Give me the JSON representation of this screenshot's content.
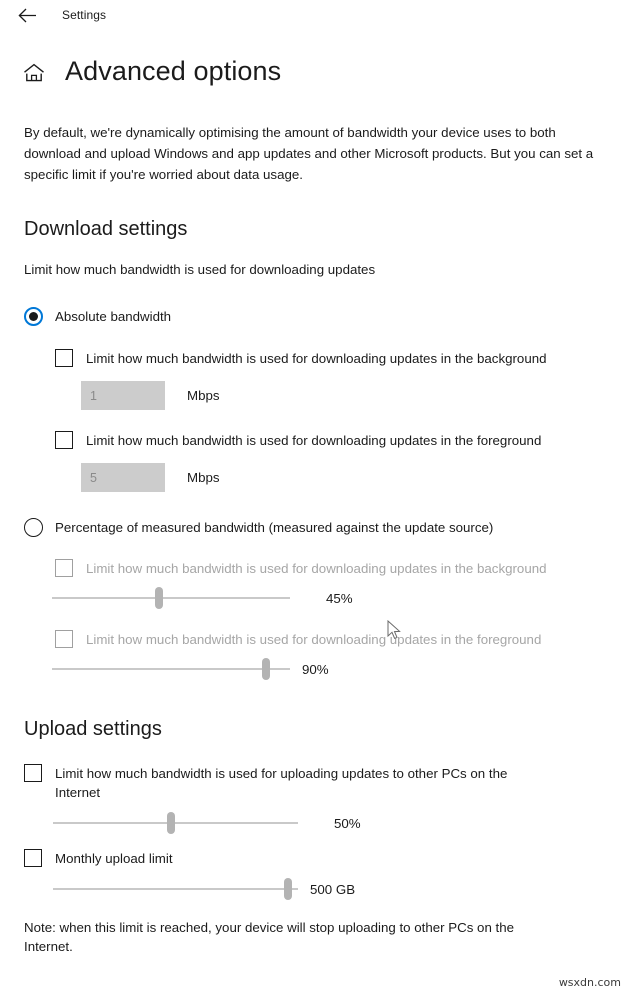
{
  "titlebar": {
    "back_icon": "back-arrow-icon",
    "app_name": "Settings"
  },
  "header": {
    "home_icon": "home-icon",
    "title": "Advanced options"
  },
  "intro": "By default, we're dynamically optimising the amount of bandwidth your device uses to both download and upload Windows and app updates and other Microsoft products. But you can set a specific limit if you're worried about data usage.",
  "download": {
    "heading": "Download settings",
    "sub_label": "Limit how much bandwidth is used for downloading updates",
    "absolute": {
      "radio_label": "Absolute bandwidth",
      "selected": true,
      "background": {
        "checkbox_label": "Limit how much bandwidth is used for downloading updates in the background",
        "checked": false,
        "value": "1",
        "unit": "Mbps"
      },
      "foreground": {
        "checkbox_label": "Limit how much bandwidth is used for downloading updates in the foreground",
        "checked": false,
        "value": "5",
        "unit": "Mbps"
      }
    },
    "percentage": {
      "radio_label": "Percentage of measured bandwidth (measured against the update source)",
      "selected": false,
      "background": {
        "checkbox_label": "Limit how much bandwidth is used for downloading updates in the background",
        "checked": false,
        "slider_value": "45%",
        "slider_percent": 45
      },
      "foreground": {
        "checkbox_label": "Limit how much bandwidth is used for downloading updates in the foreground",
        "checked": false,
        "slider_value": "90%",
        "slider_percent": 90
      }
    }
  },
  "upload": {
    "heading": "Upload settings",
    "internet_limit": {
      "checkbox_label": "Limit how much bandwidth is used for uploading updates to other PCs on the Internet",
      "checked": false,
      "slider_value": "50%",
      "slider_percent": 50
    },
    "monthly_limit": {
      "checkbox_label": "Monthly upload limit",
      "checked": false,
      "slider_value": "500 GB",
      "slider_percent": 96
    },
    "note": "Note: when this limit is reached, your device will stop uploading to other PCs on the Internet."
  },
  "watermark": "wsxdn.com",
  "colors": {
    "accent": "#0078d7",
    "text": "#1b1b1b",
    "disabled_text": "#a6a6a6",
    "input_bg": "#cccccc",
    "track": "#c9c9c9",
    "thumb": "#b3b3b3"
  }
}
